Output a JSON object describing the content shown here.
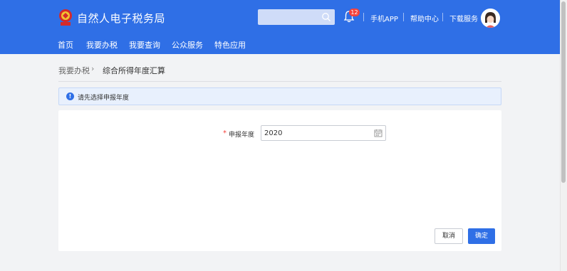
{
  "header": {
    "brand": "自然人电子税务局",
    "notification_count": "12",
    "links": [
      "手机APP",
      "帮助中心",
      "下载服务"
    ],
    "color": "#2f6fe6"
  },
  "nav": {
    "items": [
      "首页",
      "我要办税",
      "我要查询",
      "公众服务",
      "特色应用"
    ]
  },
  "breadcrumb": {
    "root": "我要办税",
    "current": "综合所得年度汇算"
  },
  "alert": {
    "text": "请先选择申报年度"
  },
  "form": {
    "required_mark": "*",
    "year_label": "申报年度",
    "year_value": "2020"
  },
  "actions": {
    "cancel": "取消",
    "ok": "确定"
  }
}
